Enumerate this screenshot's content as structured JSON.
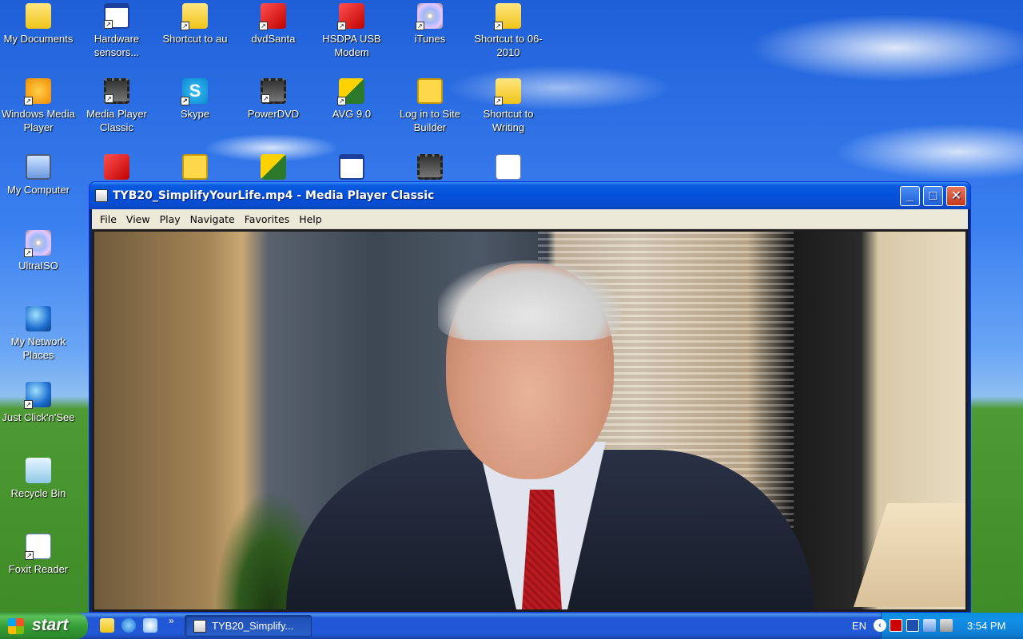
{
  "desktop": {
    "icons": [
      {
        "label": "My Documents"
      },
      {
        "label": "Hardware sensors..."
      },
      {
        "label": "Shortcut to au"
      },
      {
        "label": "dvdSanta"
      },
      {
        "label": "HSDPA USB Modem"
      },
      {
        "label": "iTunes"
      },
      {
        "label": "Shortcut to 06-2010"
      },
      {
        "label": "Windows Media Player"
      },
      {
        "label": "Media Player Classic"
      },
      {
        "label": "Skype"
      },
      {
        "label": "PowerDVD"
      },
      {
        "label": "AVG 9.0"
      },
      {
        "label": "Log in to Site Builder"
      },
      {
        "label": "Shortcut to Writing"
      },
      {
        "label": "My Computer"
      },
      {
        "label": "UltraISO"
      },
      {
        "label": "My Network Places"
      },
      {
        "label": "Just Click'n'See"
      },
      {
        "label": "Recycle Bin"
      },
      {
        "label": "Foxit Reader"
      }
    ]
  },
  "window": {
    "title": "TYB20_SimplifyYourLife.mp4 - Media Player Classic",
    "menu": [
      "File",
      "View",
      "Play",
      "Navigate",
      "Favorites",
      "Help"
    ],
    "buttons": {
      "minimize": "_",
      "maximize": "□",
      "close": "✕"
    }
  },
  "taskbar": {
    "start_label": "start",
    "task_label": "TYB20_Simplify...",
    "quick_launch_more": "»",
    "language": "EN",
    "clock": "3:54 PM",
    "tray_chevron": "‹"
  }
}
